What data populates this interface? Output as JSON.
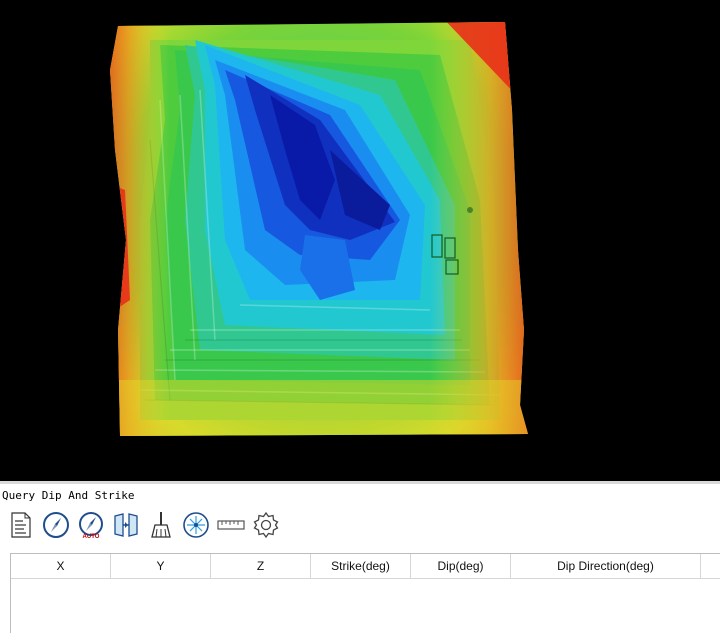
{
  "panel": {
    "title": "Query Dip And Strike"
  },
  "toolbar": {
    "tools": [
      {
        "icon": "document-list-icon",
        "tooltip": ""
      },
      {
        "icon": "compass-icon",
        "tooltip": ""
      },
      {
        "icon": "compass-auto-icon",
        "label": "AUTO"
      },
      {
        "icon": "plane-fit-icon",
        "tooltip": ""
      },
      {
        "icon": "broom-clear-icon",
        "tooltip": ""
      },
      {
        "icon": "stereonet-icon",
        "tooltip": ""
      },
      {
        "icon": "ruler-icon",
        "tooltip": ""
      },
      {
        "icon": "gear-settings-icon",
        "tooltip": ""
      }
    ]
  },
  "table": {
    "columns": [
      "X",
      "Y",
      "Z",
      "Strike(deg)",
      "Dip(deg)",
      "Dip Direction(deg)"
    ],
    "rows": []
  },
  "colors": {
    "viewport_bg": "#000000",
    "low": "#0a1aa8",
    "mid_low": "#22c8e8",
    "mid": "#3ec83a",
    "mid_high": "#e9e62a",
    "high": "#e8301a"
  }
}
